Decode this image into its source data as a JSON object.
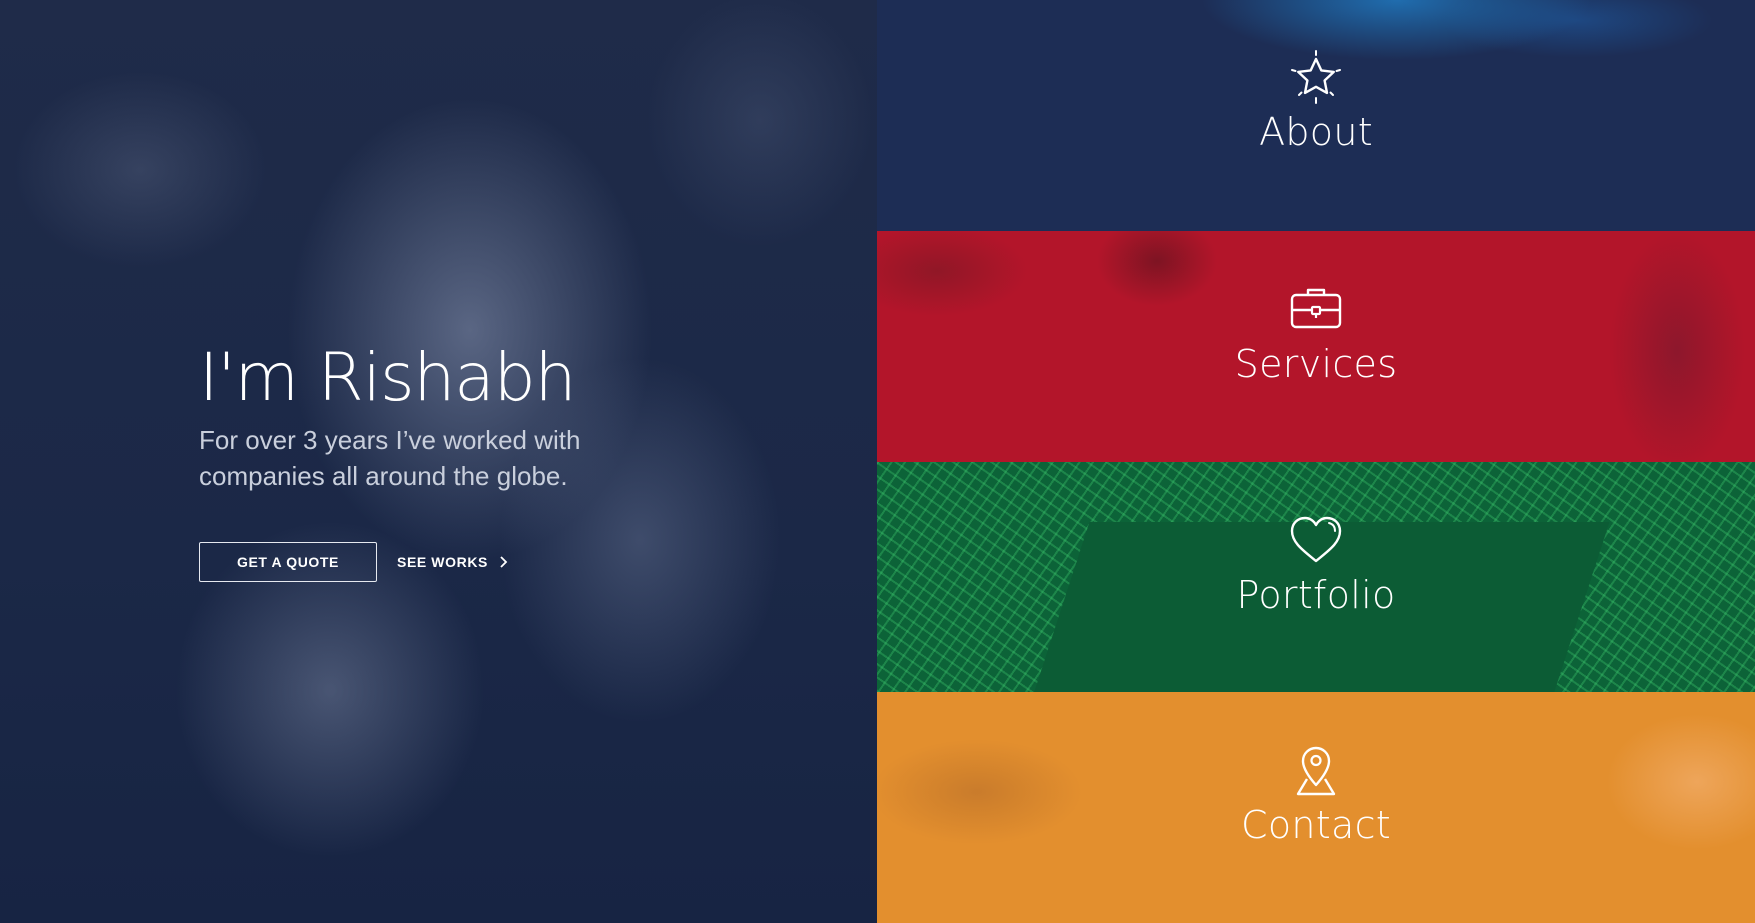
{
  "hero": {
    "title": "I'm Rishabh",
    "subtitle": "For over 3 years I’ve worked with companies all around the globe.",
    "quote_button": "GET A QUOTE",
    "works_link": "SEE WORKS"
  },
  "nav": {
    "items": [
      {
        "label": "About",
        "icon": "star-icon",
        "color": "#1d2d55"
      },
      {
        "label": "Services",
        "icon": "briefcase-icon",
        "color": "#b3152a"
      },
      {
        "label": "Portfolio",
        "icon": "heart-icon",
        "color": "#0c6338"
      },
      {
        "label": "Contact",
        "icon": "map-pin-icon",
        "color": "#e38f2e"
      }
    ]
  }
}
